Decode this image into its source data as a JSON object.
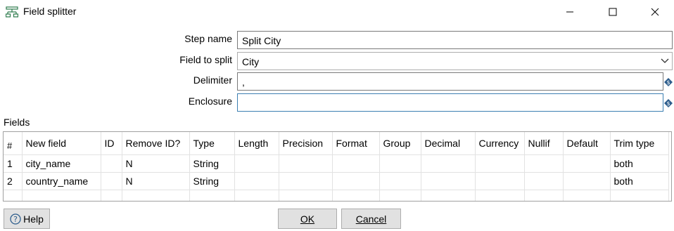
{
  "window": {
    "title": "Field splitter",
    "app_icon": "field-splitter-icon",
    "controls": [
      "minimize-icon",
      "maximize-icon",
      "close-icon"
    ]
  },
  "form": {
    "step_name_label": "Step name",
    "step_name_value": "Split City",
    "field_to_split_label": "Field to split",
    "field_to_split_value": "City",
    "delimiter_label": "Delimiter",
    "delimiter_value": ",",
    "enclosure_label": "Enclosure",
    "enclosure_value": ""
  },
  "fields": {
    "label": "Fields",
    "columns": [
      "#",
      "New field",
      "ID",
      "Remove ID?",
      "Type",
      "Length",
      "Precision",
      "Format",
      "Group",
      "Decimal",
      "Currency",
      "Nullif",
      "Default",
      "Trim type"
    ],
    "rows": [
      [
        "1",
        "city_name",
        "",
        "N",
        "String",
        "",
        "",
        "",
        "",
        "",
        "",
        "",
        "",
        "both"
      ],
      [
        "2",
        "country_name",
        "",
        "N",
        "String",
        "",
        "",
        "",
        "",
        "",
        "",
        "",
        "",
        "both"
      ]
    ]
  },
  "buttons": {
    "help_label": "Help",
    "ok_label": "OK",
    "cancel_label": "Cancel"
  },
  "colors": {
    "focus_border": "#3c7fb1",
    "button_bg": "#e1e1e1",
    "variable_icon": "#2d5d8c"
  }
}
